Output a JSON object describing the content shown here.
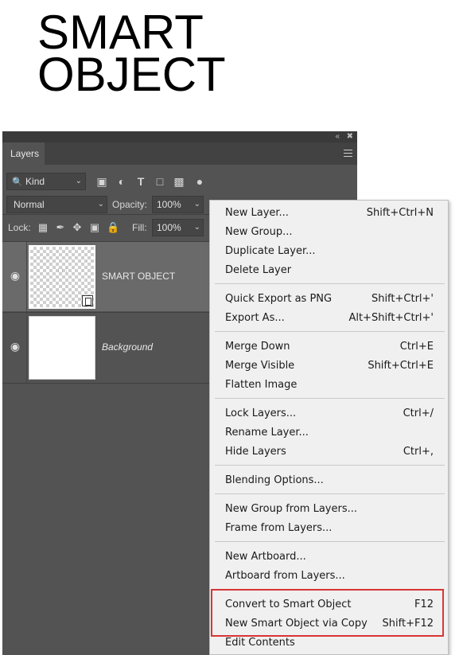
{
  "heading": {
    "line1": "SMART",
    "line2": "OBJECT"
  },
  "panel": {
    "tab": "Layers",
    "filter": {
      "kind_label": "Kind"
    },
    "blend_mode": "Normal",
    "opacity_label": "Opacity:",
    "opacity_value": "100%",
    "lock_label": "Lock:",
    "fill_label": "Fill:",
    "fill_value": "100%",
    "layers": [
      {
        "name": "SMART OBJECT",
        "selected": true
      },
      {
        "name": "Background",
        "selected": false
      }
    ]
  },
  "context_menu": {
    "items": [
      {
        "label": "New Layer...",
        "shortcut": "Shift+Ctrl+N"
      },
      {
        "label": "New Group...",
        "shortcut": ""
      },
      {
        "label": "Duplicate Layer...",
        "shortcut": ""
      },
      {
        "label": "Delete Layer",
        "shortcut": ""
      },
      {
        "label": "Quick Export as PNG",
        "shortcut": "Shift+Ctrl+'"
      },
      {
        "label": "Export As...",
        "shortcut": "Alt+Shift+Ctrl+'"
      },
      {
        "label": "Merge Down",
        "shortcut": "Ctrl+E"
      },
      {
        "label": "Merge Visible",
        "shortcut": "Shift+Ctrl+E"
      },
      {
        "label": "Flatten Image",
        "shortcut": ""
      },
      {
        "label": "Lock Layers...",
        "shortcut": "Ctrl+/"
      },
      {
        "label": "Rename Layer...",
        "shortcut": ""
      },
      {
        "label": "Hide Layers",
        "shortcut": "Ctrl+,"
      },
      {
        "label": "Blending Options...",
        "shortcut": ""
      },
      {
        "label": "New Group from Layers...",
        "shortcut": ""
      },
      {
        "label": "Frame from Layers...",
        "shortcut": ""
      },
      {
        "label": "New Artboard...",
        "shortcut": ""
      },
      {
        "label": "Artboard from Layers...",
        "shortcut": ""
      },
      {
        "label": "Convert to Smart Object",
        "shortcut": "F12"
      },
      {
        "label": "New Smart Object via Copy",
        "shortcut": "Shift+F12"
      },
      {
        "label": "Edit Contents",
        "shortcut": ""
      }
    ]
  },
  "colors": {
    "panel_bg": "#535353",
    "selected_layer": "#6a6a6a",
    "menu_bg": "#f0f0f0",
    "highlight_border": "#d83535"
  }
}
